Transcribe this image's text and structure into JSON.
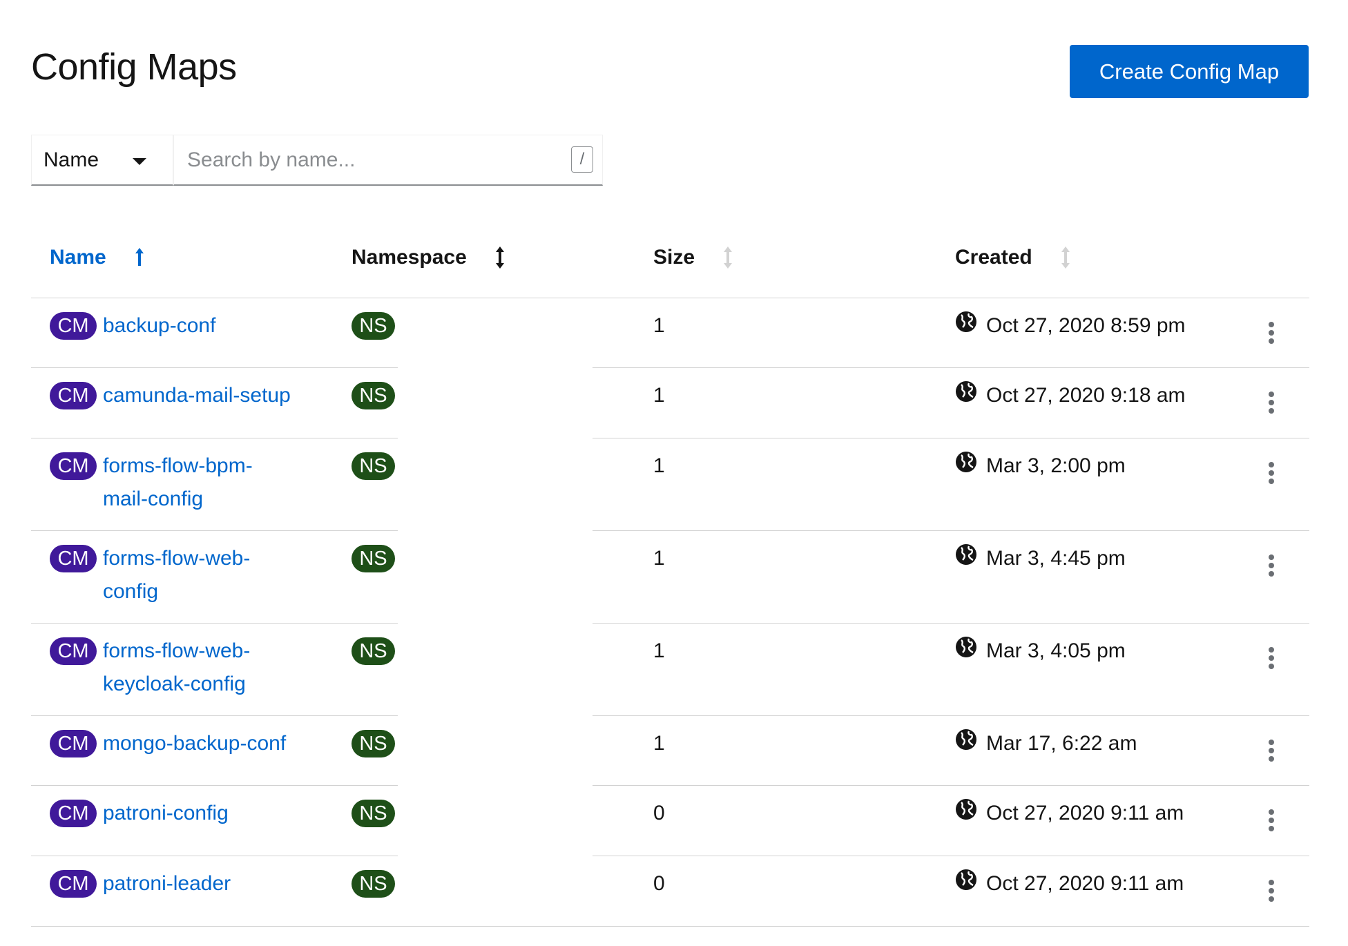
{
  "header": {
    "title": "Config Maps",
    "create_label": "Create Config Map"
  },
  "filter": {
    "type_label": "Name",
    "placeholder": "Search by name...",
    "shortcut_hint": "/"
  },
  "table": {
    "columns": [
      {
        "label": "Name",
        "sort": "ascending-active"
      },
      {
        "label": "Namespace",
        "sort": "sortable"
      },
      {
        "label": "Size",
        "sort": "inactive"
      },
      {
        "label": "Created",
        "sort": "inactive"
      }
    ],
    "rows": [
      {
        "badge": "CM",
        "name": "backup-conf",
        "ns_badge": "NS",
        "size": "1",
        "created": "Oct 27, 2020 8:59 pm"
      },
      {
        "badge": "CM",
        "name": "camunda-mail-setup",
        "ns_badge": "NS",
        "size": "1",
        "created": "Oct 27, 2020 9:18 am"
      },
      {
        "badge": "CM",
        "name": "forms-flow-bpm-mail-config",
        "ns_badge": "NS",
        "size": "1",
        "created": "Mar 3, 2:00 pm"
      },
      {
        "badge": "CM",
        "name": "forms-flow-web-config",
        "ns_badge": "NS",
        "size": "1",
        "created": "Mar 3, 4:45 pm"
      },
      {
        "badge": "CM",
        "name": "forms-flow-web-keycloak-config",
        "ns_badge": "NS",
        "size": "1",
        "created": "Mar 3, 4:05 pm"
      },
      {
        "badge": "CM",
        "name": "mongo-backup-conf",
        "ns_badge": "NS",
        "size": "1",
        "created": "Mar 17, 6:22 am"
      },
      {
        "badge": "CM",
        "name": "patroni-config",
        "ns_badge": "NS",
        "size": "0",
        "created": "Oct 27, 2020 9:11 am"
      },
      {
        "badge": "CM",
        "name": "patroni-leader",
        "ns_badge": "NS",
        "size": "0",
        "created": "Oct 27, 2020 9:11 am"
      }
    ]
  },
  "colors": {
    "primary": "#0066cc",
    "cm_badge": "#40199a",
    "ns_badge": "#1e4f18"
  },
  "icons": {
    "sort_active": "long-arrow-up-icon",
    "sort_sortable": "arrows-alt-v-icon",
    "timestamp": "globe-icon",
    "row_actions": "kebab-icon",
    "filter_caret": "caret-down-icon"
  }
}
